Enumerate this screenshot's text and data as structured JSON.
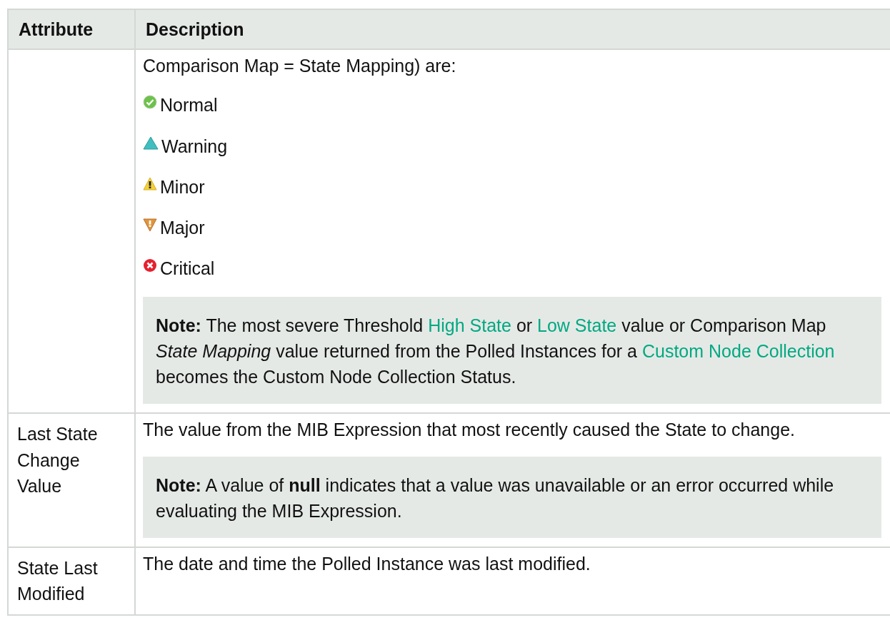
{
  "table": {
    "columns": [
      "Attribute",
      "Description"
    ],
    "rows": [
      {
        "attribute": "",
        "blocks": [
          {
            "kind": "paragraph",
            "segments": [
              {
                "kind": "text",
                "text": "Comparison Map = State Mapping) are:"
              }
            ]
          },
          {
            "kind": "normal",
            "label": "Normal"
          },
          {
            "kind": "warning",
            "label": "Warning"
          },
          {
            "kind": "minor",
            "label": "Minor"
          },
          {
            "kind": "major",
            "label": "Major"
          },
          {
            "kind": "critical",
            "label": "Critical"
          },
          {
            "kind": "note",
            "segments": [
              {
                "kind": "text",
                "text": "**Note:** The most severe Threshold "
              },
              {
                "kind": "link",
                "text": "High State"
              },
              {
                "kind": "text",
                "text": " or "
              },
              {
                "kind": "link",
                "text": "Low State"
              },
              {
                "kind": "text",
                "text": " value or Comparison Map *State Mapping* value returned from the Polled Instances for a "
              },
              {
                "kind": "link",
                "text": "Custom Node Collection"
              },
              {
                "kind": "text",
                "text": " becomes the Custom Node Collection Status."
              }
            ]
          }
        ]
      },
      {
        "attribute": "Last State Change Value",
        "blocks": [
          {
            "kind": "paragraph",
            "segments": [
              {
                "kind": "text",
                "text": "The value from the MIB Expression that most recently caused the State to change."
              }
            ]
          },
          {
            "kind": "note",
            "segments": [
              {
                "kind": "text",
                "text": "**Note:** A value of **null** indicates that a value was unavailable or an error occurred while evaluating the MIB Expression."
              }
            ]
          }
        ]
      },
      {
        "attribute": "State Last Modified",
        "blocks": [
          {
            "kind": "paragraph",
            "segments": [
              {
                "kind": "text",
                "text": "The date and time the Polled Instance was last modified."
              }
            ]
          }
        ]
      }
    ]
  }
}
